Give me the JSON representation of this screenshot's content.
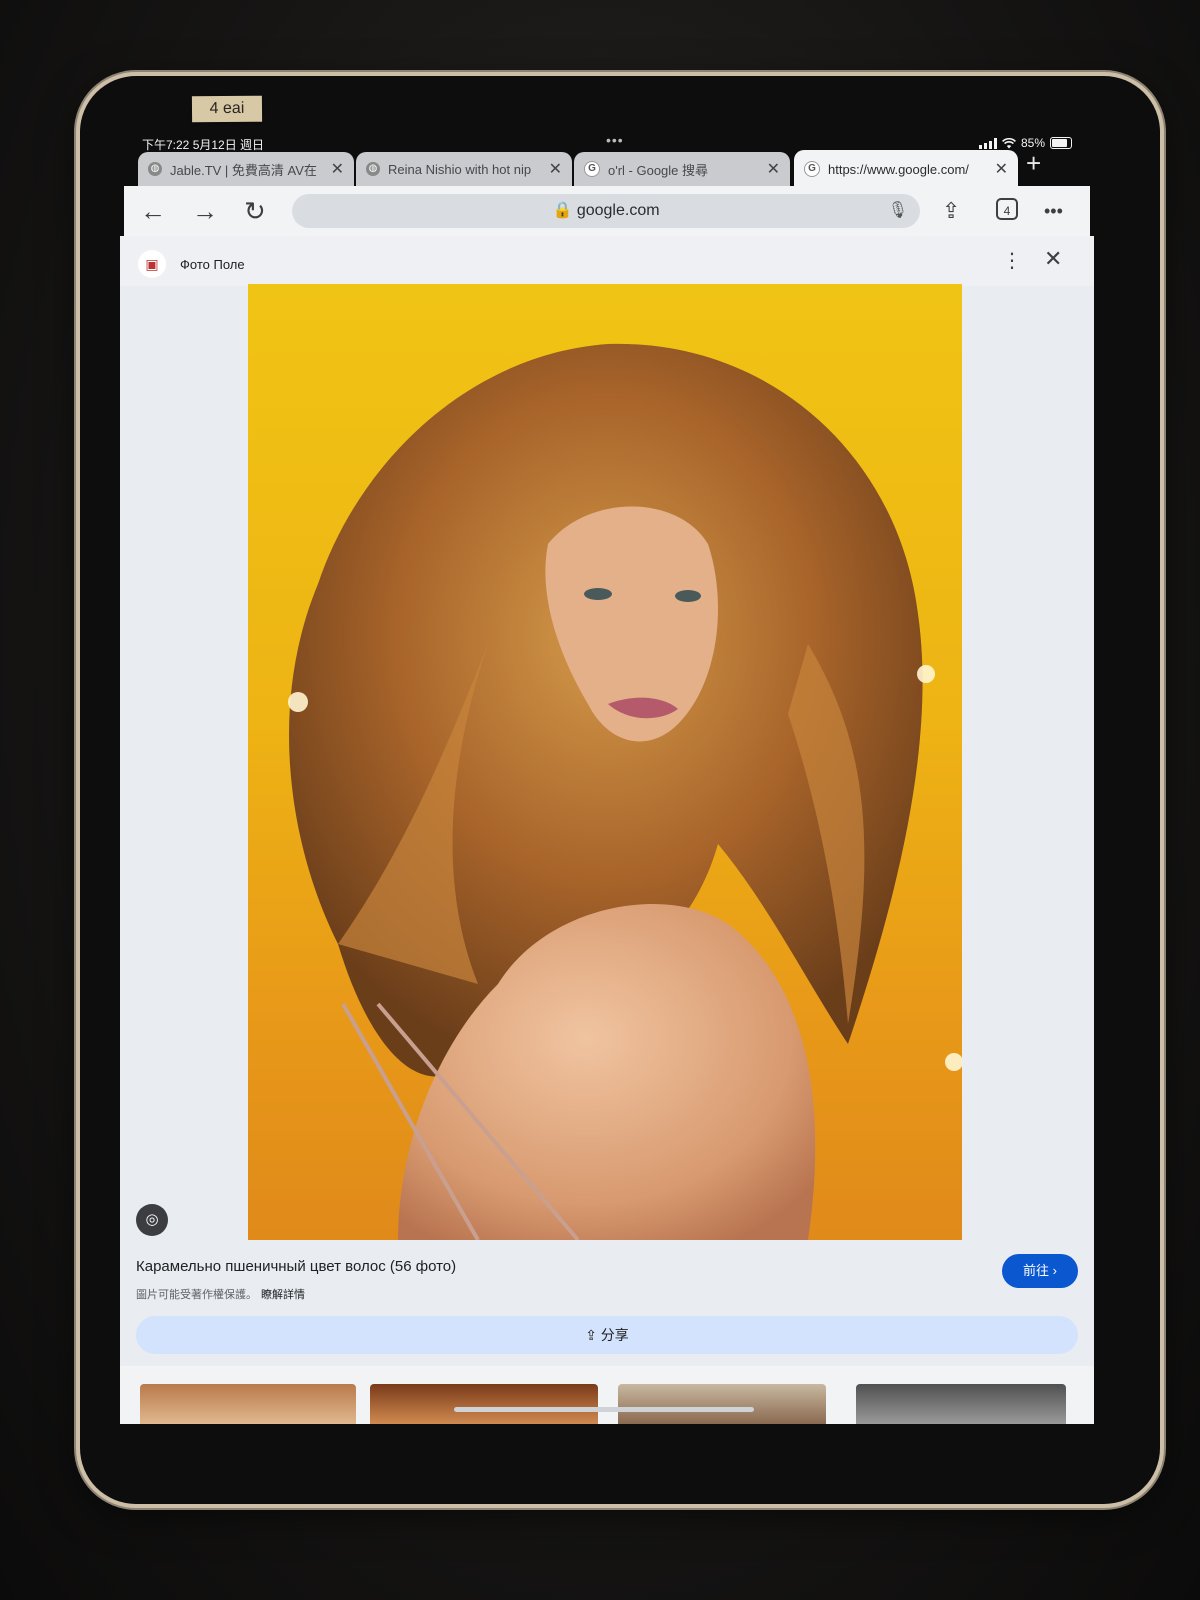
{
  "tape_label": "4 eai",
  "status": {
    "time_date": "下午7:22  5月12日 週日",
    "battery": "85%"
  },
  "multitask_dots": "•••",
  "tabs": [
    {
      "label": "Jable.TV | 免費高清 AV在",
      "close": "✕"
    },
    {
      "label": "Reina Nishio with hot nip",
      "close": "✕"
    },
    {
      "label": "o'rl - Google 搜尋",
      "close": "✕"
    },
    {
      "label": "https://www.google.com/",
      "close": "✕"
    }
  ],
  "new_tab": "+",
  "toolbar": {
    "back": "←",
    "forward": "→",
    "reload": "↻",
    "url": "🔒 google.com",
    "mic": "🎙",
    "share": "⇪",
    "tab_count": "4",
    "more": "•••"
  },
  "source": {
    "name": "Фото Поле",
    "more": "⋮",
    "close": "✕"
  },
  "photo_caption": "Карамельно пшеничный цвет волос (56 фото)",
  "copyright": {
    "text": "圖片可能受著作權保護。",
    "link": "瞭解詳情"
  },
  "go_button": "前往 ›",
  "share_button": "⇪ 分享",
  "colors": {
    "accent": "#0b57d0",
    "share_bg": "#d3e3fd",
    "photo_bg": "#eeb414"
  }
}
